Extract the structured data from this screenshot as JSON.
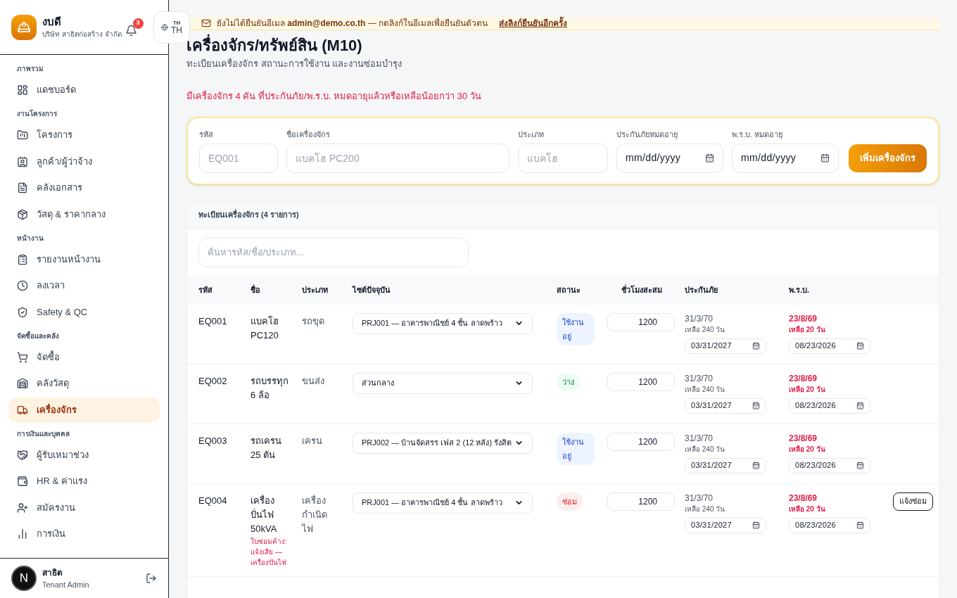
{
  "brand": {
    "name": "งบดี",
    "company": "บริษัท สาธิตก่อสร้าง จำกัด"
  },
  "notifications": {
    "count": "3"
  },
  "language": {
    "small": "TH",
    "code": "TH"
  },
  "sidebar": {
    "sections": [
      {
        "title": "ภาพรวม",
        "items": [
          {
            "label": "แดชบอร์ด",
            "selected": false
          }
        ]
      },
      {
        "title": "งานโครงการ",
        "items": [
          {
            "label": "โครงการ",
            "selected": false
          },
          {
            "label": "ลูกค้า/ผู้ว่าจ้าง",
            "selected": false
          },
          {
            "label": "คลังเอกสาร",
            "selected": false
          },
          {
            "label": "วัสดุ & ราคากลาง",
            "selected": false
          }
        ]
      },
      {
        "title": "หน้างาน",
        "items": [
          {
            "label": "รายงานหน้างาน",
            "selected": false
          },
          {
            "label": "ลงเวลา",
            "selected": false
          },
          {
            "label": "Safety & QC",
            "selected": false
          }
        ]
      },
      {
        "title": "จัดซื้อและคลัง",
        "items": [
          {
            "label": "จัดซื้อ",
            "selected": false
          },
          {
            "label": "คลังวัสดุ",
            "selected": false
          },
          {
            "label": "เครื่องจักร",
            "selected": true
          }
        ]
      },
      {
        "title": "การเงินและบุคคล",
        "items": [
          {
            "label": "ผู้รับเหมาช่วง",
            "selected": false
          },
          {
            "label": "HR & ค่าแรง",
            "selected": false
          },
          {
            "label": "สมัครงาน",
            "selected": false
          },
          {
            "label": "การเงิน",
            "selected": false
          }
        ]
      }
    ],
    "user": {
      "name": "สาธิต",
      "role": "Tenant Admin"
    },
    "dev_badge": "N"
  },
  "banner": {
    "before": "ยังไม่ได้ยืนยันอีเมล",
    "email": "admin@demo.co.th",
    "after": "— กดลิงก์ในอีเมลเพื่อยืนยันตัวตน",
    "link": "ส่งลิงก์ยืนยันอีกครั้ง"
  },
  "page": {
    "title": "เครื่องจักร/ทรัพย์สิน (M10)",
    "subtitle": "ทะเบียนเครื่องจักร สถานะการใช้งาน และงานซ่อมบำรุง",
    "alert": "มีเครื่องจักร 4 คัน ที่ประกันภัย/พ.ร.บ. หมดอายุแล้วหรือเหลือน้อยกว่า 30 วัน"
  },
  "form": {
    "fields": [
      {
        "label": "รหัส",
        "placeholder": "EQ001",
        "kind": "text"
      },
      {
        "label": "ชื่อเครื่องจักร",
        "placeholder": "แบคโฮ PC200",
        "kind": "text"
      },
      {
        "label": "ประเภท",
        "placeholder": "แบคโฮ",
        "kind": "text"
      },
      {
        "label": "ประกันภัยหมดอายุ",
        "placeholder": "mm/dd/yyyy",
        "kind": "date"
      },
      {
        "label": "พ.ร.บ. หมดอายุ",
        "placeholder": "mm/dd/yyyy",
        "kind": "date"
      }
    ],
    "submit": "เพิ่มเครื่องจักร"
  },
  "table": {
    "title": "ทะเบียนเครื่องจักร (4 รายการ)",
    "search_placeholder": "ค้นหารหัส/ชื่อ/ประเภท...",
    "columns": [
      "รหัส",
      "ชื่อ",
      "ประเภท",
      "ไซต์ปัจจุบัน",
      "สถานะ",
      "ชั่วโมงสะสม",
      "ประกันภัย",
      "พ.ร.บ."
    ],
    "rows": [
      {
        "code": "EQ001",
        "name": "แบคโฮ PC120",
        "type": "รถขุด",
        "site": "PRJ001 — อาคารพาณิชย์ 4 ชั้น ลาดพร้าว",
        "status": {
          "label": "ใช้งานอยู่",
          "kind": "in_use"
        },
        "hours": "1200",
        "insurance": {
          "date": "31/3/70",
          "remaining": "เหลือ 240 วัน",
          "value": "03/31/2027",
          "warning": false
        },
        "prb": {
          "date": "23/8/69",
          "remaining": "เหลือ 20 วัน",
          "value": "08/23/2026",
          "warning": true
        }
      },
      {
        "code": "EQ002",
        "name": "รถบรรทุก 6 ล้อ",
        "type": "ขนส่ง",
        "site": "ส่วนกลาง",
        "status": {
          "label": "ว่าง",
          "kind": "idle"
        },
        "hours": "1200",
        "insurance": {
          "date": "31/3/70",
          "remaining": "เหลือ 240 วัน",
          "value": "03/31/2027",
          "warning": false
        },
        "prb": {
          "date": "23/8/69",
          "remaining": "เหลือ 20 วัน",
          "value": "08/23/2026",
          "warning": true
        }
      },
      {
        "code": "EQ003",
        "name": "รถเครน 25 ตัน",
        "type": "เครน",
        "site": "PRJ002 — บ้านจัดสรร เฟส 2 (12 หลัง) รังสิต",
        "status": {
          "label": "ใช้งานอยู่",
          "kind": "in_use"
        },
        "hours": "1200",
        "insurance": {
          "date": "31/3/70",
          "remaining": "เหลือ 240 วัน",
          "value": "03/31/2027",
          "warning": false
        },
        "prb": {
          "date": "23/8/69",
          "remaining": "เหลือ 20 วัน",
          "value": "08/23/2026",
          "warning": true
        }
      },
      {
        "code": "EQ004",
        "name": "เครื่องปั่นไฟ 50kVA",
        "note": "ใบซ่อมค้าง: แจ้งเสีย — เครื่องปั่นไฟ",
        "type": "เครื่องกำเนิดไฟ",
        "site": "PRJ001 — อาคารพาณิชย์ 4 ชั้น ลาดพร้าว",
        "status": {
          "label": "ซ่อม",
          "kind": "repair"
        },
        "hours": "1200",
        "insurance": {
          "date": "31/3/70",
          "remaining": "เหลือ 240 วัน",
          "value": "03/31/2027",
          "warning": false
        },
        "prb": {
          "date": "23/8/69",
          "remaining": "เหลือ 20 วัน",
          "value": "08/23/2026",
          "warning": true
        },
        "action": "แจ้งซ่อม"
      }
    ]
  }
}
